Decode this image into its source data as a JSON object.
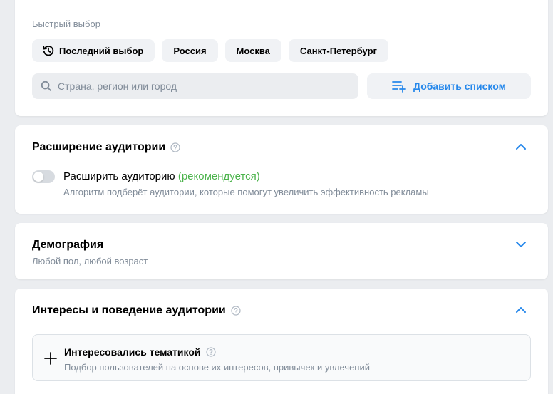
{
  "geo": {
    "quick_label": "Быстрый выбор",
    "chips": [
      {
        "label": "Последний выбор",
        "icon": "history-icon"
      },
      {
        "label": "Россия"
      },
      {
        "label": "Москва"
      },
      {
        "label": "Санкт-Петербург"
      }
    ],
    "search_placeholder": "Страна, регион или город",
    "add_list_label": "Добавить списком"
  },
  "expand": {
    "title": "Расширение аудитории",
    "toggle_label": "Расширить аудиторию",
    "toggle_recommended": "(рекомендуется)",
    "toggle_state": "off",
    "toggle_desc": "Алгоритм подберёт аудитории, которые помогут увеличить эффективность рекламы",
    "chevron": "chevron-up-icon"
  },
  "demo": {
    "title": "Демография",
    "subtitle": "Любой пол, любой возраст",
    "chevron": "chevron-down-icon"
  },
  "interests": {
    "title": "Интересы и поведение аудитории",
    "chevron": "chevron-up-icon",
    "item_title": "Интересовались тематикой",
    "item_desc": "Подбор пользователей на основе их интересов, привычек и увлечений"
  },
  "colors": {
    "accent": "#2688eb",
    "secondary_text": "#818c99",
    "recommended": "#4bb34b",
    "background": "#ebedf0"
  }
}
